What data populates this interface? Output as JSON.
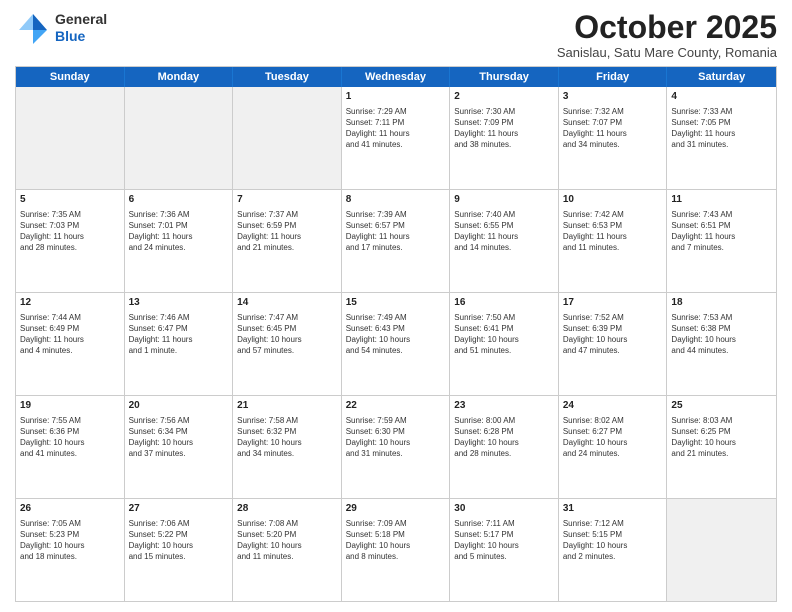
{
  "header": {
    "logo_general": "General",
    "logo_blue": "Blue",
    "month_title": "October 2025",
    "subtitle": "Sanislau, Satu Mare County, Romania"
  },
  "days_of_week": [
    "Sunday",
    "Monday",
    "Tuesday",
    "Wednesday",
    "Thursday",
    "Friday",
    "Saturday"
  ],
  "rows": [
    [
      {
        "day": "",
        "info": "",
        "shaded": true
      },
      {
        "day": "",
        "info": "",
        "shaded": true
      },
      {
        "day": "",
        "info": "",
        "shaded": true
      },
      {
        "day": "1",
        "info": "Sunrise: 7:29 AM\nSunset: 7:11 PM\nDaylight: 11 hours\nand 41 minutes.",
        "shaded": false
      },
      {
        "day": "2",
        "info": "Sunrise: 7:30 AM\nSunset: 7:09 PM\nDaylight: 11 hours\nand 38 minutes.",
        "shaded": false
      },
      {
        "day": "3",
        "info": "Sunrise: 7:32 AM\nSunset: 7:07 PM\nDaylight: 11 hours\nand 34 minutes.",
        "shaded": false
      },
      {
        "day": "4",
        "info": "Sunrise: 7:33 AM\nSunset: 7:05 PM\nDaylight: 11 hours\nand 31 minutes.",
        "shaded": false
      }
    ],
    [
      {
        "day": "5",
        "info": "Sunrise: 7:35 AM\nSunset: 7:03 PM\nDaylight: 11 hours\nand 28 minutes.",
        "shaded": false
      },
      {
        "day": "6",
        "info": "Sunrise: 7:36 AM\nSunset: 7:01 PM\nDaylight: 11 hours\nand 24 minutes.",
        "shaded": false
      },
      {
        "day": "7",
        "info": "Sunrise: 7:37 AM\nSunset: 6:59 PM\nDaylight: 11 hours\nand 21 minutes.",
        "shaded": false
      },
      {
        "day": "8",
        "info": "Sunrise: 7:39 AM\nSunset: 6:57 PM\nDaylight: 11 hours\nand 17 minutes.",
        "shaded": false
      },
      {
        "day": "9",
        "info": "Sunrise: 7:40 AM\nSunset: 6:55 PM\nDaylight: 11 hours\nand 14 minutes.",
        "shaded": false
      },
      {
        "day": "10",
        "info": "Sunrise: 7:42 AM\nSunset: 6:53 PM\nDaylight: 11 hours\nand 11 minutes.",
        "shaded": false
      },
      {
        "day": "11",
        "info": "Sunrise: 7:43 AM\nSunset: 6:51 PM\nDaylight: 11 hours\nand 7 minutes.",
        "shaded": false
      }
    ],
    [
      {
        "day": "12",
        "info": "Sunrise: 7:44 AM\nSunset: 6:49 PM\nDaylight: 11 hours\nand 4 minutes.",
        "shaded": false
      },
      {
        "day": "13",
        "info": "Sunrise: 7:46 AM\nSunset: 6:47 PM\nDaylight: 11 hours\nand 1 minute.",
        "shaded": false
      },
      {
        "day": "14",
        "info": "Sunrise: 7:47 AM\nSunset: 6:45 PM\nDaylight: 10 hours\nand 57 minutes.",
        "shaded": false
      },
      {
        "day": "15",
        "info": "Sunrise: 7:49 AM\nSunset: 6:43 PM\nDaylight: 10 hours\nand 54 minutes.",
        "shaded": false
      },
      {
        "day": "16",
        "info": "Sunrise: 7:50 AM\nSunset: 6:41 PM\nDaylight: 10 hours\nand 51 minutes.",
        "shaded": false
      },
      {
        "day": "17",
        "info": "Sunrise: 7:52 AM\nSunset: 6:39 PM\nDaylight: 10 hours\nand 47 minutes.",
        "shaded": false
      },
      {
        "day": "18",
        "info": "Sunrise: 7:53 AM\nSunset: 6:38 PM\nDaylight: 10 hours\nand 44 minutes.",
        "shaded": false
      }
    ],
    [
      {
        "day": "19",
        "info": "Sunrise: 7:55 AM\nSunset: 6:36 PM\nDaylight: 10 hours\nand 41 minutes.",
        "shaded": false
      },
      {
        "day": "20",
        "info": "Sunrise: 7:56 AM\nSunset: 6:34 PM\nDaylight: 10 hours\nand 37 minutes.",
        "shaded": false
      },
      {
        "day": "21",
        "info": "Sunrise: 7:58 AM\nSunset: 6:32 PM\nDaylight: 10 hours\nand 34 minutes.",
        "shaded": false
      },
      {
        "day": "22",
        "info": "Sunrise: 7:59 AM\nSunset: 6:30 PM\nDaylight: 10 hours\nand 31 minutes.",
        "shaded": false
      },
      {
        "day": "23",
        "info": "Sunrise: 8:00 AM\nSunset: 6:28 PM\nDaylight: 10 hours\nand 28 minutes.",
        "shaded": false
      },
      {
        "day": "24",
        "info": "Sunrise: 8:02 AM\nSunset: 6:27 PM\nDaylight: 10 hours\nand 24 minutes.",
        "shaded": false
      },
      {
        "day": "25",
        "info": "Sunrise: 8:03 AM\nSunset: 6:25 PM\nDaylight: 10 hours\nand 21 minutes.",
        "shaded": false
      }
    ],
    [
      {
        "day": "26",
        "info": "Sunrise: 7:05 AM\nSunset: 5:23 PM\nDaylight: 10 hours\nand 18 minutes.",
        "shaded": false
      },
      {
        "day": "27",
        "info": "Sunrise: 7:06 AM\nSunset: 5:22 PM\nDaylight: 10 hours\nand 15 minutes.",
        "shaded": false
      },
      {
        "day": "28",
        "info": "Sunrise: 7:08 AM\nSunset: 5:20 PM\nDaylight: 10 hours\nand 11 minutes.",
        "shaded": false
      },
      {
        "day": "29",
        "info": "Sunrise: 7:09 AM\nSunset: 5:18 PM\nDaylight: 10 hours\nand 8 minutes.",
        "shaded": false
      },
      {
        "day": "30",
        "info": "Sunrise: 7:11 AM\nSunset: 5:17 PM\nDaylight: 10 hours\nand 5 minutes.",
        "shaded": false
      },
      {
        "day": "31",
        "info": "Sunrise: 7:12 AM\nSunset: 5:15 PM\nDaylight: 10 hours\nand 2 minutes.",
        "shaded": false
      },
      {
        "day": "",
        "info": "",
        "shaded": true
      }
    ]
  ]
}
